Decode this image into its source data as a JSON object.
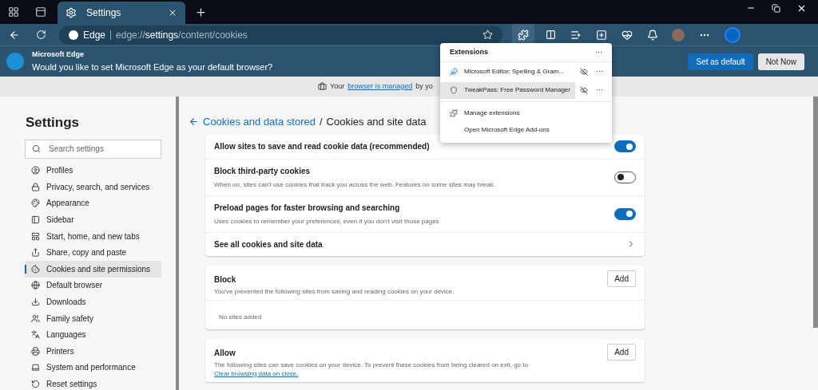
{
  "tabs": [
    {
      "label": "Settings",
      "selected": true
    }
  ],
  "address_bar": {
    "site": "Edge",
    "url_scheme": "edge://",
    "url_host": "settings",
    "url_path": "/content/cookies"
  },
  "infobar": {
    "title": "Microsoft Edge",
    "message": "Would you like to set Microsoft Edge as your default browser?",
    "primary_button": "Set as default",
    "secondary_button": "Not Now"
  },
  "managed_bar": {
    "prefix": "Your",
    "link": "browser is managed",
    "suffix": "by yo"
  },
  "extensions_menu": {
    "title": "Extensions",
    "more": "···",
    "items": [
      {
        "label": "Microsoft Editor: Spelling & Gram...",
        "selected": false
      },
      {
        "label": "TweakPass: Free Password Manager",
        "selected": true
      }
    ],
    "links": [
      {
        "kind": "manage",
        "label": "Manage extensions"
      },
      {
        "kind": "addons",
        "label": "Open Microsoft Edge Add-ons"
      }
    ]
  },
  "sidebar": {
    "title": "Settings",
    "search_placeholder": "Search settings",
    "items": [
      {
        "label": "Profiles",
        "selected": false
      },
      {
        "label": "Privacy, search, and services",
        "selected": false
      },
      {
        "label": "Appearance",
        "selected": false
      },
      {
        "label": "Sidebar",
        "selected": false
      },
      {
        "label": "Start, home, and new tabs",
        "selected": false
      },
      {
        "label": "Share, copy and paste",
        "selected": false
      },
      {
        "label": "Cookies and site permissions",
        "selected": true
      },
      {
        "label": "Default browser",
        "selected": false
      },
      {
        "label": "Downloads",
        "selected": false
      },
      {
        "label": "Family safety",
        "selected": false
      },
      {
        "label": "Languages",
        "selected": false
      },
      {
        "label": "Printers",
        "selected": false
      },
      {
        "label": "System and performance",
        "selected": false
      },
      {
        "label": "Reset settings",
        "selected": false
      }
    ]
  },
  "page": {
    "breadcrumb_link": "Cookies and data stored",
    "separator": "/",
    "title": "Cookies and site data",
    "settings": [
      {
        "kind": "toggle",
        "title": "Allow sites to save and read cookie data (recommended)",
        "on": true
      },
      {
        "kind": "toggle",
        "title": "Block third-party cookies",
        "description": "When on, sites can't use cookies that track you across the web. Features on some sites may break.",
        "on": false
      },
      {
        "kind": "toggle",
        "title": "Preload pages for faster browsing and searching",
        "description": "Uses cookies to remember your preferences, even if you don't visit those pages",
        "on": true
      },
      {
        "kind": "link",
        "title": "See all cookies and site data"
      }
    ],
    "sections": [
      {
        "title": "Block",
        "description": "You've prevented the following sites from saving and reading cookies on your device.",
        "button": "Add",
        "empty": "No sites added"
      },
      {
        "title": "Allow",
        "description": "The following sites can save cookies on your device. To prevent these cookies from being cleared on exit, go to",
        "link": "Clear browsing data on close.",
        "button": "Add"
      }
    ]
  }
}
